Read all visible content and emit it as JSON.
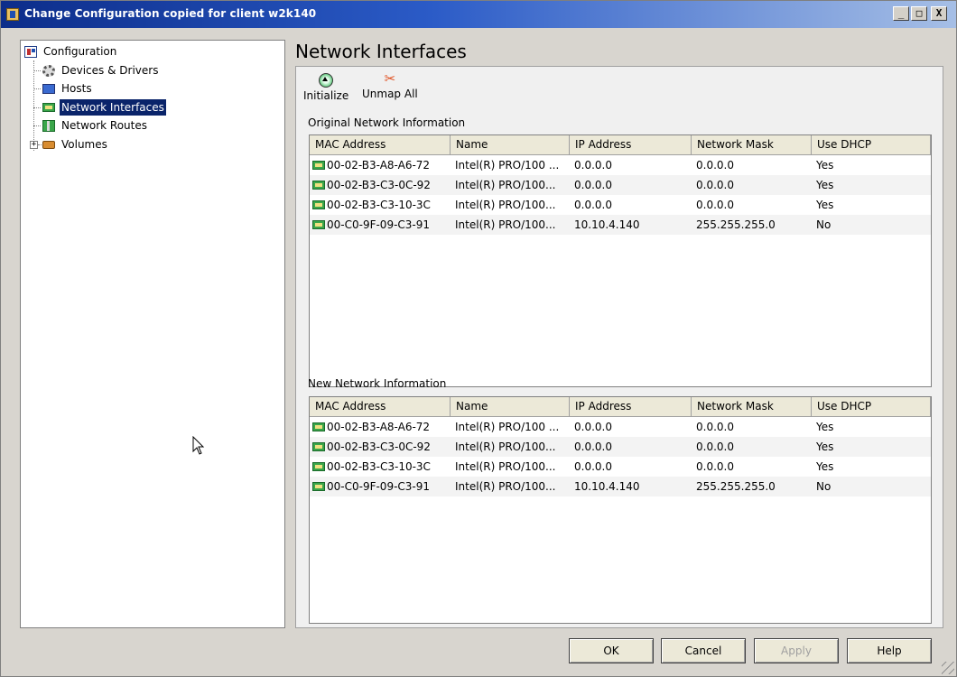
{
  "window": {
    "title": "Change Configuration copied for client w2k140",
    "minimize_label": "_",
    "maximize_label": "□",
    "close_label": "X"
  },
  "tree": {
    "root": "Configuration",
    "items": [
      {
        "label": "Devices & Drivers",
        "icon": "gear-icon"
      },
      {
        "label": "Hosts",
        "icon": "monitor-icon"
      },
      {
        "label": "Network Interfaces",
        "icon": "network-card-icon",
        "selected": true
      },
      {
        "label": "Network Routes",
        "icon": "network-route-icon"
      },
      {
        "label": "Volumes",
        "icon": "disk-icon",
        "expandable": true
      }
    ],
    "expander_symbol": "+"
  },
  "main": {
    "title": "Network Interfaces",
    "toolbar": {
      "initialize_label": "Initialize",
      "unmap_all_label": "Unmap All"
    },
    "columns": [
      "MAC Address",
      "Name",
      "IP Address",
      "Network Mask",
      "Use DHCP"
    ],
    "original": {
      "label": "Original Network Information",
      "rows": [
        [
          "00-02-B3-A8-A6-72",
          "Intel(R) PRO/100 ...",
          "0.0.0.0",
          "0.0.0.0",
          "Yes"
        ],
        [
          "00-02-B3-C3-0C-92",
          "Intel(R) PRO/100...",
          "0.0.0.0",
          "0.0.0.0",
          "Yes"
        ],
        [
          "00-02-B3-C3-10-3C",
          "Intel(R) PRO/100...",
          "0.0.0.0",
          "0.0.0.0",
          "Yes"
        ],
        [
          "00-C0-9F-09-C3-91",
          "Intel(R) PRO/100...",
          "10.10.4.140",
          "255.255.255.0",
          "No"
        ]
      ]
    },
    "new": {
      "label": "New Network Information",
      "rows": [
        [
          "00-02-B3-A8-A6-72",
          "Intel(R) PRO/100 ...",
          "0.0.0.0",
          "0.0.0.0",
          "Yes"
        ],
        [
          "00-02-B3-C3-0C-92",
          "Intel(R) PRO/100...",
          "0.0.0.0",
          "0.0.0.0",
          "Yes"
        ],
        [
          "00-02-B3-C3-10-3C",
          "Intel(R) PRO/100...",
          "0.0.0.0",
          "0.0.0.0",
          "Yes"
        ],
        [
          "00-C0-9F-09-C3-91",
          "Intel(R) PRO/100...",
          "10.10.4.140",
          "255.255.255.0",
          "No"
        ]
      ]
    }
  },
  "buttons": {
    "ok": "OK",
    "cancel": "Cancel",
    "apply": "Apply",
    "help": "Help"
  },
  "colors": {
    "selection": "#0a246a",
    "titlebar_start": "#0c2d8a",
    "titlebar_end": "#a6bfe6",
    "nic_icon": "#3aa64a"
  }
}
